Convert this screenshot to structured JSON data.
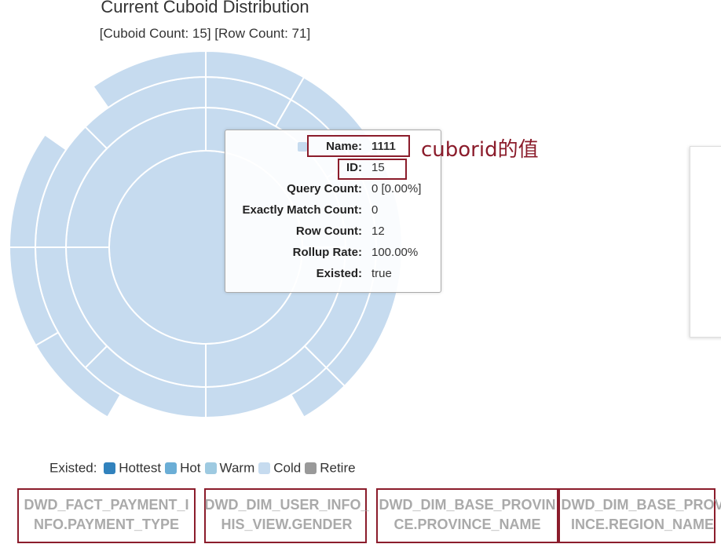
{
  "title": "Current Cuboid Distribution",
  "subtitle": "[Cuboid Count: 15] [Row Count: 71]",
  "tooltip": {
    "rows": [
      {
        "label": "Name:",
        "value": "1111"
      },
      {
        "label": "ID:",
        "value": "15"
      },
      {
        "label": "Query Count:",
        "value": "0 [0.00%]"
      },
      {
        "label": "Exactly Match Count:",
        "value": "0"
      },
      {
        "label": "Row Count:",
        "value": "12"
      },
      {
        "label": "Rollup Rate:",
        "value": "100.00%"
      },
      {
        "label": "Existed:",
        "value": "true"
      }
    ]
  },
  "annotation": "cuborid的值",
  "legend": {
    "label": "Existed:",
    "items": [
      {
        "name": "Hottest",
        "color": "#3182bd"
      },
      {
        "name": "Hot",
        "color": "#6baed6"
      },
      {
        "name": "Warm",
        "color": "#9ecae1"
      },
      {
        "name": "Cold",
        "color": "#c6dbef"
      },
      {
        "name": "Retire",
        "color": "#999999"
      }
    ]
  },
  "dimensions": [
    "DWD_FACT_PAYMENT_INFO.PAYMENT_TYPE",
    "DWD_DIM_USER_INFO_HIS_VIEW.GENDER",
    "DWD_DIM_BASE_PROVINCE.PROVINCE_NAME",
    "DWD_DIM_BASE_PROVINCE.REGION_NAME"
  ],
  "chart_data": {
    "type": "sunburst",
    "title": "Current Cuboid Distribution",
    "subtitle": "[Cuboid Count: 15] [Row Count: 71]",
    "fill_color": "#c6dbef",
    "rings": [
      {
        "level": 1,
        "segments": [
          {
            "start": 0,
            "end": 360
          }
        ]
      },
      {
        "level": 2,
        "segments": [
          {
            "start": 0,
            "end": 90
          },
          {
            "start": 90,
            "end": 180
          },
          {
            "start": 180,
            "end": 270
          },
          {
            "start": 270,
            "end": 360
          }
        ]
      },
      {
        "level": 3,
        "segments": [
          {
            "start": 0,
            "end": 30
          },
          {
            "start": 30,
            "end": 60
          },
          {
            "start": 60,
            "end": 135
          },
          {
            "start": 135,
            "end": 180
          },
          {
            "start": 180,
            "end": 225
          },
          {
            "start": 225,
            "end": 270
          },
          {
            "start": 270,
            "end": 315
          },
          {
            "start": 315,
            "end": 360
          }
        ]
      },
      {
        "level": 4,
        "segments": [
          {
            "start": 0,
            "end": 30
          },
          {
            "start": 30,
            "end": 60
          },
          {
            "start": 60,
            "end": 135
          },
          {
            "start": 135,
            "end": 150
          },
          {
            "start": 210,
            "end": 240
          },
          {
            "start": 240,
            "end": 270
          },
          {
            "start": 270,
            "end": 305
          },
          {
            "start": 325,
            "end": 360
          }
        ]
      }
    ]
  }
}
